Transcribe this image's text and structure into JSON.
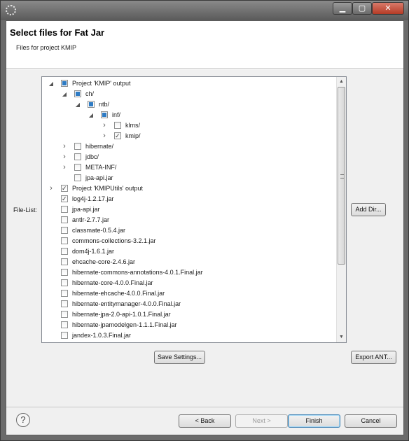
{
  "window": {
    "title": ""
  },
  "header": {
    "title": "Select files for Fat Jar",
    "subtitle": "Files for project KMIP"
  },
  "filelist": {
    "label": "File-List:",
    "items": [
      {
        "label": "Project 'KMIP' output",
        "level": 0,
        "twisty": "expanded",
        "state": "partial"
      },
      {
        "label": "ch/",
        "level": 1,
        "twisty": "expanded",
        "state": "partial"
      },
      {
        "label": "ntb/",
        "level": 2,
        "twisty": "expanded",
        "state": "partial"
      },
      {
        "label": "inf/",
        "level": 3,
        "twisty": "expanded",
        "state": "partial"
      },
      {
        "label": "klms/",
        "level": 4,
        "twisty": "collapsed",
        "state": "unchecked"
      },
      {
        "label": "kmip/",
        "level": 4,
        "twisty": "collapsed",
        "state": "checked"
      },
      {
        "label": "hibernate/",
        "level": 1,
        "twisty": "collapsed",
        "state": "unchecked"
      },
      {
        "label": "jdbc/",
        "level": 1,
        "twisty": "collapsed",
        "state": "unchecked"
      },
      {
        "label": "META-INF/",
        "level": 1,
        "twisty": "collapsed",
        "state": "unchecked"
      },
      {
        "label": "jpa-api.jar",
        "level": 1,
        "twisty": "none",
        "state": "unchecked"
      },
      {
        "label": "Project 'KMIPUtils' output",
        "level": 0,
        "twisty": "collapsed",
        "state": "checked"
      },
      {
        "label": "log4j-1.2.17.jar",
        "level": 0,
        "twisty": "none",
        "state": "checked"
      },
      {
        "label": "jpa-api.jar",
        "level": 0,
        "twisty": "none",
        "state": "unchecked"
      },
      {
        "label": "antlr-2.7.7.jar",
        "level": 0,
        "twisty": "none",
        "state": "unchecked"
      },
      {
        "label": "classmate-0.5.4.jar",
        "level": 0,
        "twisty": "none",
        "state": "unchecked"
      },
      {
        "label": "commons-collections-3.2.1.jar",
        "level": 0,
        "twisty": "none",
        "state": "unchecked"
      },
      {
        "label": "dom4j-1.6.1.jar",
        "level": 0,
        "twisty": "none",
        "state": "unchecked"
      },
      {
        "label": "ehcache-core-2.4.6.jar",
        "level": 0,
        "twisty": "none",
        "state": "unchecked"
      },
      {
        "label": "hibernate-commons-annotations-4.0.1.Final.jar",
        "level": 0,
        "twisty": "none",
        "state": "unchecked"
      },
      {
        "label": "hibernate-core-4.0.0.Final.jar",
        "level": 0,
        "twisty": "none",
        "state": "unchecked"
      },
      {
        "label": "hibernate-ehcache-4.0.0.Final.jar",
        "level": 0,
        "twisty": "none",
        "state": "unchecked"
      },
      {
        "label": "hibernate-entitymanager-4.0.0.Final.jar",
        "level": 0,
        "twisty": "none",
        "state": "unchecked"
      },
      {
        "label": "hibernate-jpa-2.0-api-1.0.1.Final.jar",
        "level": 0,
        "twisty": "none",
        "state": "unchecked"
      },
      {
        "label": "hibernate-jpamodelgen-1.1.1.Final.jar",
        "level": 0,
        "twisty": "none",
        "state": "unchecked"
      },
      {
        "label": "jandex-1.0.3.Final.jar",
        "level": 0,
        "twisty": "none",
        "state": "unchecked"
      }
    ]
  },
  "buttons": {
    "add_dir": "Add Dir...",
    "save_settings": "Save Settings...",
    "export_ant": "Export ANT...",
    "back": "< Back",
    "next": "Next >",
    "finish": "Finish",
    "cancel": "Cancel"
  },
  "icons": {
    "help": "?",
    "app": "eclipse-icon",
    "minimize": "▁",
    "maximize": "▢",
    "close": "✕"
  },
  "colors": {
    "accent": "#2e7bc4",
    "titlebar": "#6e6e6e"
  }
}
